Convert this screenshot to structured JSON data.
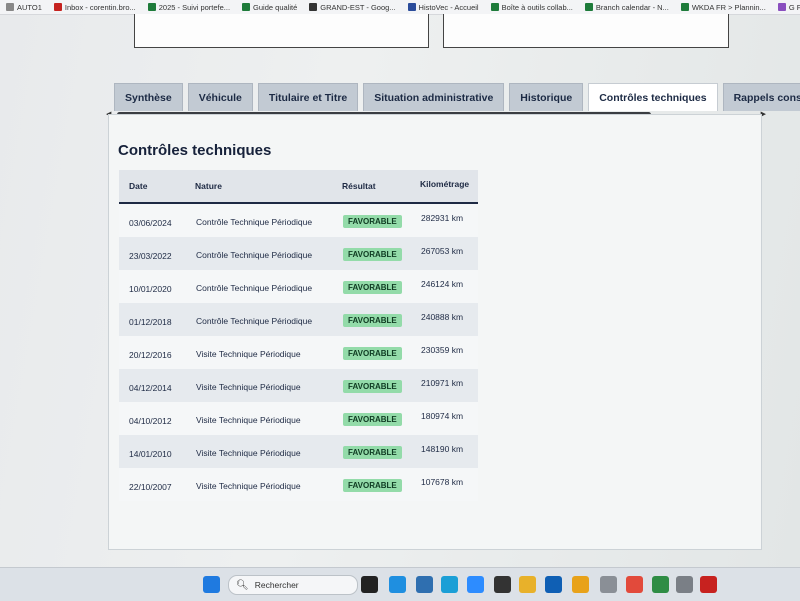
{
  "bookmarks": [
    {
      "label": "AUTO1",
      "color": "#888888"
    },
    {
      "label": "Inbox - corentin.bro...",
      "color": "#c5221f"
    },
    {
      "label": "2025 - Suivi portefe...",
      "color": "#1e7b3a"
    },
    {
      "label": "Guide qualité",
      "color": "#1e7b3a"
    },
    {
      "label": "GRAND-EST - Goog...",
      "color": "#333333"
    },
    {
      "label": "HistoVec - Accueil",
      "color": "#2b4c9b"
    },
    {
      "label": "Boîte à outils collab...",
      "color": "#1e7b3a"
    },
    {
      "label": "Branch calendar - N...",
      "color": "#1e7b3a"
    },
    {
      "label": "WKDA FR > Plannin...",
      "color": "#1e7b3a"
    },
    {
      "label": "G FORM Contrats a",
      "color": "#8a4fbf"
    }
  ],
  "tabs": [
    {
      "label": "Synthèse",
      "active": false
    },
    {
      "label": "Véhicule",
      "active": false
    },
    {
      "label": "Titulaire et Titre",
      "active": false
    },
    {
      "label": "Situation administrative",
      "active": false
    },
    {
      "label": "Historique",
      "active": false
    },
    {
      "label": "Contrôles techniques",
      "active": true
    },
    {
      "label": "Rappels constructeur",
      "active": false
    }
  ],
  "section": {
    "title": "Contrôles techniques"
  },
  "table": {
    "headers": [
      "Date",
      "Nature",
      "Résultat",
      "Kilométrage"
    ],
    "rows": [
      {
        "date": "03/06/2024",
        "nature": "Contrôle Technique Périodique",
        "result": "FAVORABLE",
        "km": "282931 km"
      },
      {
        "date": "23/03/2022",
        "nature": "Contrôle Technique Périodique",
        "result": "FAVORABLE",
        "km": "267053 km"
      },
      {
        "date": "10/01/2020",
        "nature": "Contrôle Technique Périodique",
        "result": "FAVORABLE",
        "km": "246124 km"
      },
      {
        "date": "01/12/2018",
        "nature": "Contrôle Technique Périodique",
        "result": "FAVORABLE",
        "km": "240888 km"
      },
      {
        "date": "20/12/2016",
        "nature": "Visite Technique Périodique",
        "result": "FAVORABLE",
        "km": "230359 km"
      },
      {
        "date": "04/12/2014",
        "nature": "Visite Technique Périodique",
        "result": "FAVORABLE",
        "km": "210971 km"
      },
      {
        "date": "04/10/2012",
        "nature": "Visite Technique Périodique",
        "result": "FAVORABLE",
        "km": "180974 km"
      },
      {
        "date": "14/01/2010",
        "nature": "Visite Technique Périodique",
        "result": "FAVORABLE",
        "km": "148190 km"
      },
      {
        "date": "22/10/2007",
        "nature": "Visite Technique Périodique",
        "result": "FAVORABLE",
        "km": "107678 km"
      }
    ]
  },
  "taskbar": {
    "search_placeholder": "Rechercher",
    "apps": [
      {
        "name": "windows-start-icon",
        "color": "#1f7ae0"
      },
      {
        "name": "file-icon",
        "color": "#222222"
      },
      {
        "name": "skype-icon",
        "color": "#1f8fe0"
      },
      {
        "name": "notepad-icon",
        "color": "#2f6fb0"
      },
      {
        "name": "edge-icon",
        "color": "#1b9fd6"
      },
      {
        "name": "zoom-icon",
        "color": "#2d8cff"
      },
      {
        "name": "sticky-notes-icon",
        "color": "#333333"
      },
      {
        "name": "folder-icon",
        "color": "#e8b12a"
      },
      {
        "name": "outlook-icon",
        "color": "#0f5fb4"
      },
      {
        "name": "chrome-icon",
        "color": "#e8a21a"
      },
      {
        "name": "printer-icon",
        "color": "#8a8f96"
      },
      {
        "name": "chrome-icon-2",
        "color": "#e24a3b"
      },
      {
        "name": "chrome-badge-icon",
        "color": "#2f8d45"
      },
      {
        "name": "settings-icon",
        "color": "#7a7f86"
      },
      {
        "name": "acrobat-icon",
        "color": "#c7221f"
      }
    ]
  }
}
